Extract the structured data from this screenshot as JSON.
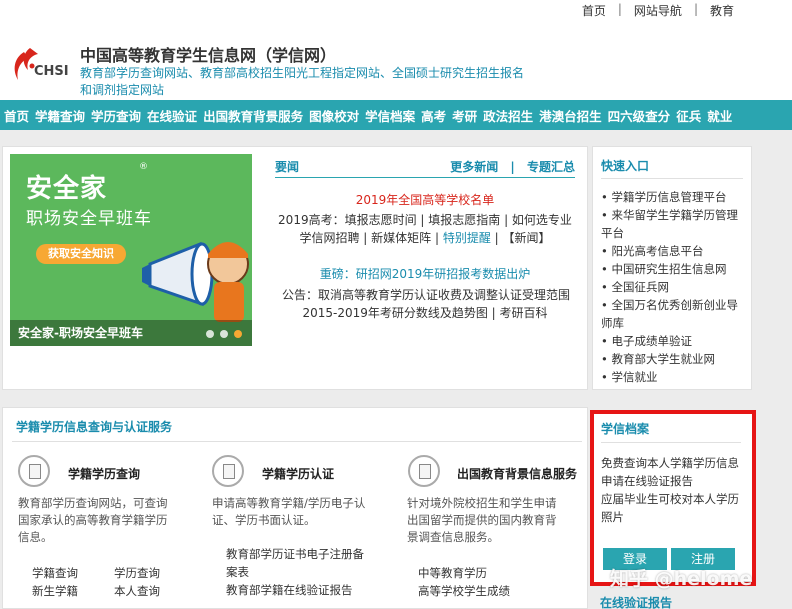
{
  "topbar": {
    "links": [
      "首页",
      "网站导航",
      "教育"
    ],
    "separator": "|"
  },
  "header": {
    "logo_text": "CHSI",
    "title": "中国高等教育学生信息网（学信网）",
    "subtitle_line1": "教育部学历查询网站、教育部高校招生阳光工程指定网站、全国硕士研究生招生报名",
    "subtitle_line2": "和调剂指定网站"
  },
  "nav": {
    "items": [
      "首页",
      "学籍查询",
      "学历查询",
      "在线验证",
      "出国教育背景服务",
      "图像校对",
      "学信档案",
      "高考",
      "考研",
      "政法招生",
      "港澳台招生",
      "四六级查分",
      "征兵",
      "就业"
    ]
  },
  "banner": {
    "title": "安全家",
    "subtitle": "职场安全早班车",
    "button": "获取安全知识",
    "caption": "安全家-职场安全早班车",
    "registered": "®"
  },
  "news": {
    "title": "要闻",
    "more": "更多新闻",
    "topics": "专题汇总",
    "sep": "|",
    "headline1": "2019年全国高等学校名单",
    "line2": "2019高考：填报志愿时间 | 填报志愿指南 | 如何选专业",
    "line3a": "学信网招聘 | 新媒体矩阵 | ",
    "line3b": "特别提醒",
    "line3c": " | 【新闻】",
    "headline2": "重磅：研招网2019年研招报考数据出炉",
    "line5": "公告：取消高等教育学历认证收费及调整认证受理范围",
    "line6": "2015-2019年考研分数线及趋势图 | 考研百科"
  },
  "quick": {
    "title": "快速入口",
    "items": [
      "学籍学历信息管理平台",
      "来华留学生学籍学历管理平台",
      "阳光高考信息平台",
      "中国研究生招生信息网",
      "全国征兵网",
      "全国万名优秀创新创业导师库",
      "电子成绩单验证",
      "教育部大学生就业网",
      "学信就业"
    ]
  },
  "services": {
    "title": "学籍学历信息查询与认证服务",
    "items": [
      {
        "name": "学籍学历查询",
        "desc": "教育部学历查询网站，可查询国家承认的高等教育学籍学历信息。"
      },
      {
        "name": "学籍学历认证",
        "desc": "申请高等教育学籍/学历电子认证、学历书面认证。"
      },
      {
        "name": "出国教育背景信息服务",
        "desc": "针对境外院校招生和学生申请出国留学而提供的国内教育背景调查信息服务。"
      }
    ],
    "links1_col1": [
      "学籍查询",
      "新生学籍"
    ],
    "links1_col2": [
      "学历查询",
      "本人查询"
    ],
    "links2": [
      "教育部学历证书电子注册备案表",
      "教育部学籍在线验证报告"
    ],
    "links3": [
      "中等教育学历",
      "高等学校学生成绩"
    ]
  },
  "dossier": {
    "title": "学信档案",
    "lines": [
      "免费查询本人学籍学历信息",
      "申请在线验证报告",
      "应届毕业生可校对本人学历照片"
    ],
    "login": "登录",
    "register": "注册",
    "next_title": "在线验证报告",
    "accent": "#e61515"
  },
  "watermark": "知乎 @helome",
  "colors": {
    "teal": "#2aa5b0",
    "link": "#1a8cad",
    "red": "#d8261c"
  }
}
